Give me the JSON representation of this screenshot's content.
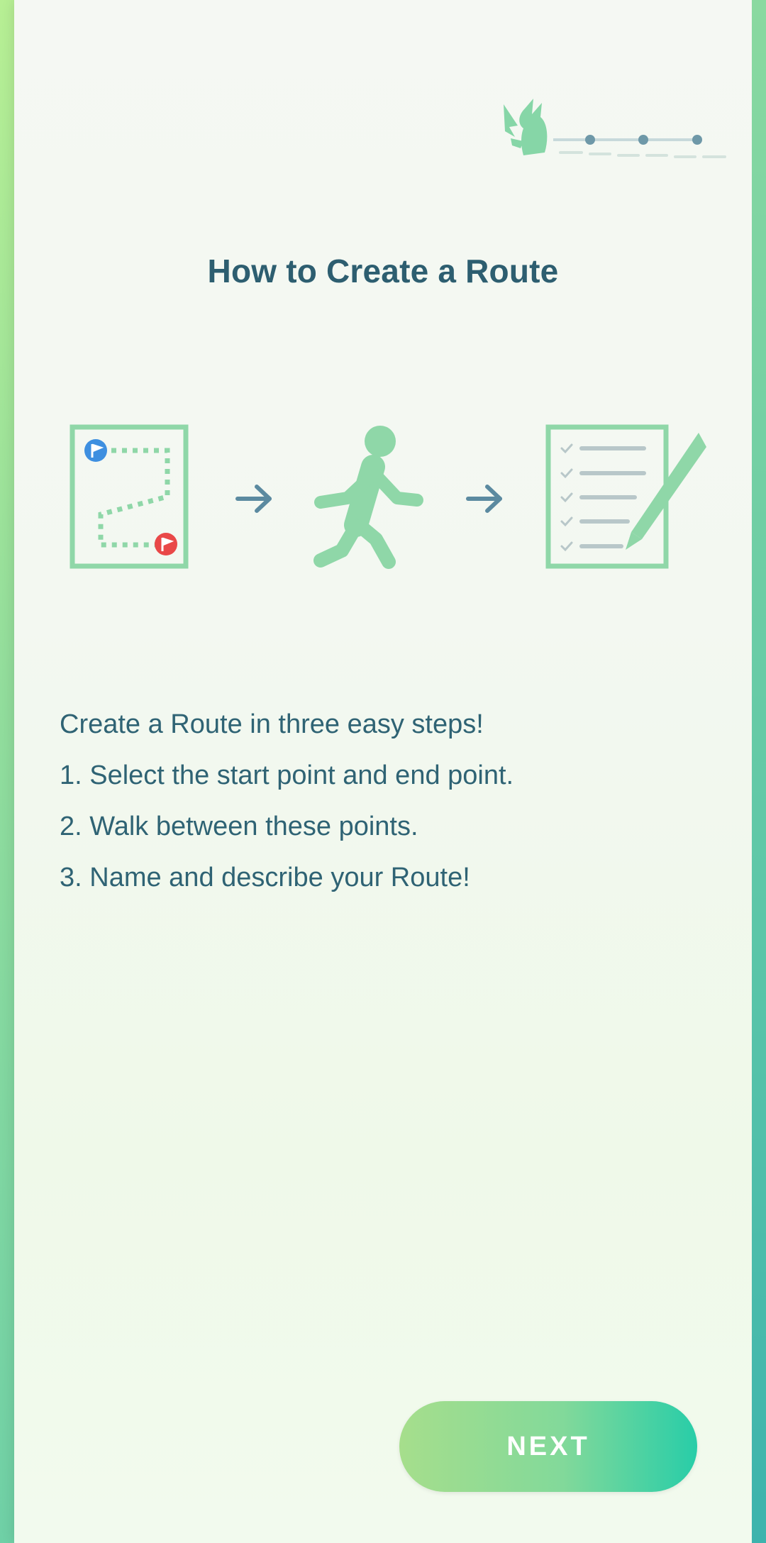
{
  "header": {
    "progress_icon": "pikachu-progress-icon",
    "progress_dots": 3
  },
  "title": "How to Create a Route",
  "illustration": {
    "step_icons": [
      "route-map-icon",
      "walking-person-icon",
      "checklist-pencil-icon"
    ],
    "arrow_icon": "arrow-right-icon",
    "colors": {
      "icon_green": "#8fd7a8",
      "arrow": "#5b8aa0",
      "start_flag": "#3e8fe0",
      "end_flag": "#e94848"
    }
  },
  "description": {
    "intro": "Create a Route in three easy steps!",
    "step1": "1. Select the start point and end point.",
    "step2": "2. Walk between these points.",
    "step3": "3. Name and describe your Route!"
  },
  "next_button": {
    "label": "NEXT"
  },
  "colors": {
    "title": "#2d5e70",
    "text": "#2f6374",
    "button_start": "#a6de8c",
    "button_end": "#28cda8"
  }
}
